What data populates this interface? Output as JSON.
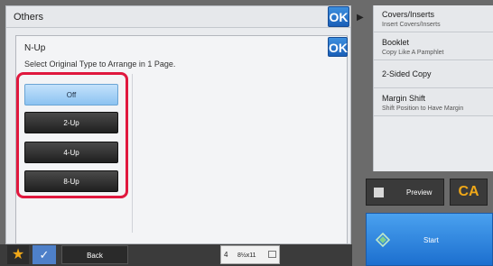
{
  "dialog": {
    "title": "Others",
    "ok_label": "OK",
    "nup": {
      "title": "N-Up",
      "instruction": "Select Original Type to Arrange in 1 Page.",
      "ok_label": "OK",
      "options": [
        {
          "label": "Off",
          "selected": true
        },
        {
          "label": "2-Up",
          "selected": false
        },
        {
          "label": "4-Up",
          "selected": false
        },
        {
          "label": "8-Up",
          "selected": false
        }
      ]
    }
  },
  "bottom_bar": {
    "back_label": "Back",
    "paper_tray": "4",
    "paper_size": "8½x11"
  },
  "menu": {
    "items": [
      {
        "title": "Covers/Inserts",
        "subtitle": "Insert Covers/Inserts"
      },
      {
        "title": "Booklet",
        "subtitle": "Copy Like A Pamphlet"
      },
      {
        "title": "2-Sided Copy",
        "subtitle": ""
      },
      {
        "title": "Margin Shift",
        "subtitle": "Shift Position to Have Margin"
      }
    ]
  },
  "actions": {
    "preview_label": "Preview",
    "ca_label": "CA",
    "start_label": "Start"
  },
  "colors": {
    "accent_blue": "#1a5fb8",
    "highlight_frame": "#e0183e",
    "selected_option": "#a9d3f6"
  }
}
